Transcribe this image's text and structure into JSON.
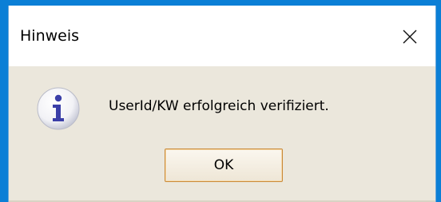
{
  "window": {
    "title": "Hinweis",
    "close_icon": "close-icon"
  },
  "dialog": {
    "icon": "info-icon",
    "message": "UserId/KW erfolgreich verifiziert.",
    "ok_label": "OK"
  },
  "colors": {
    "desktop": "#0b7fd6",
    "titlebar": "#ffffff",
    "dialog_bg": "#ebe7dc",
    "icon_blue": "#3b3fa8",
    "button_border": "#c98a3a"
  }
}
